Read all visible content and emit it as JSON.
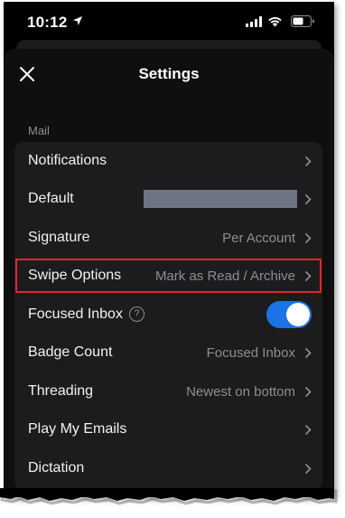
{
  "status_bar": {
    "time": "10:12"
  },
  "header": {
    "title": "Settings"
  },
  "section": {
    "label": "Mail"
  },
  "rows": [
    {
      "label": "Notifications",
      "value": ""
    },
    {
      "label": "Default",
      "value": ""
    },
    {
      "label": "Signature",
      "value": "Per Account"
    },
    {
      "label": "Swipe Options",
      "value": "Mark as Read / Archive"
    },
    {
      "label": "Focused Inbox",
      "value": ""
    },
    {
      "label": "Badge Count",
      "value": "Focused Inbox"
    },
    {
      "label": "Threading",
      "value": "Newest on bottom"
    },
    {
      "label": "Play My Emails",
      "value": ""
    },
    {
      "label": "Dictation",
      "value": ""
    }
  ],
  "focused_inbox_toggle": {
    "on": true
  },
  "help_glyph": "?",
  "colors": {
    "background": "#000000",
    "group": "#1c1c1e",
    "accent": "#1a73e8",
    "highlight": "#e0262c",
    "secondary_text": "#8e8e93"
  },
  "icons": [
    "location-arrow-icon",
    "cellular-signal-icon",
    "wifi-icon",
    "battery-icon",
    "close-icon",
    "chevron-right-icon",
    "help-icon"
  ]
}
